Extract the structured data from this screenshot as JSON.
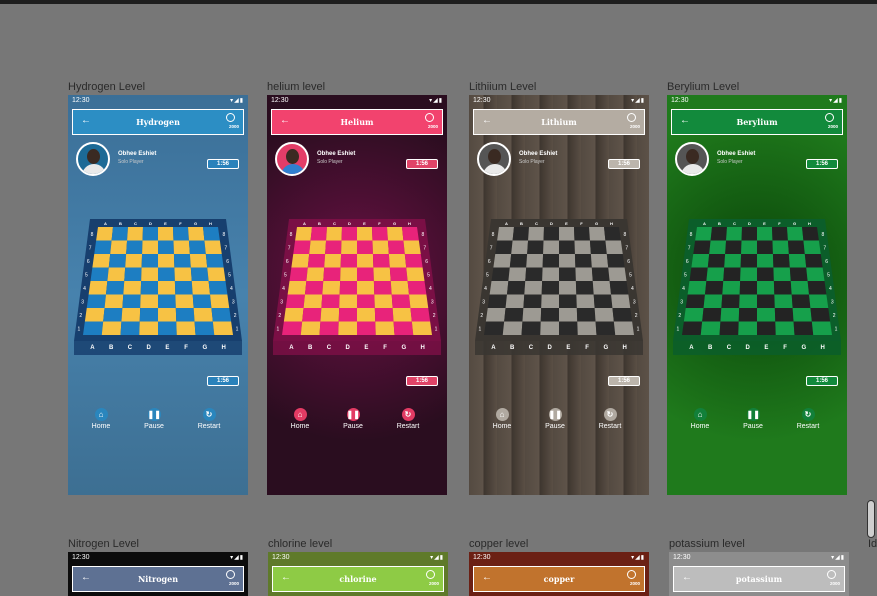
{
  "frames": [
    {
      "label": "Hydrogen Level",
      "title": "Hydrogen",
      "time": "12:30",
      "coins": "2000",
      "player": "Obhee Eshiet",
      "role": "Solo Player",
      "timer_top": "1:56",
      "timer_bottom": "1:56",
      "colors": {
        "bg": "#4179a3",
        "bgAlt": "#2f5f83",
        "header": "#2c8ec4",
        "light": "#f7c244",
        "dark": "#1d7ec2",
        "border": "#173f6e",
        "accent": "#2a86bd",
        "timer": "#2a82bb",
        "avatar": "#1c6a96"
      }
    },
    {
      "label": "helium level",
      "title": "Helium",
      "time": "12:30",
      "coins": "2000",
      "player": "Obhee Eshiet",
      "role": "Solo Player",
      "timer_top": "1:56",
      "timer_bottom": "1:56",
      "colors": {
        "bg": "#2a0d1f",
        "bgAlt": "#6b1145",
        "header": "#f2436e",
        "light": "#f7c244",
        "dark": "#e8237a",
        "border": "#7a0f45",
        "accent": "#e33b64",
        "timer": "#e04468",
        "avatar": "#e33d68"
      }
    },
    {
      "label": "Lithiium Level",
      "title": "Lithium",
      "time": "12:30",
      "coins": "2000",
      "player": "Obhee Eshiet",
      "role": "Solo Player",
      "timer_top": "1:56",
      "timer_bottom": "1:56",
      "colors": {
        "bg": "#5a4f45",
        "bgAlt": "#3f3730",
        "header": "#b4aca2",
        "light": "#9d9a93",
        "dark": "#2a2a2a",
        "border": "#3a3631",
        "accent": "#b0a9a0",
        "timer": "#bcb5ac",
        "avatar": "#555555"
      }
    },
    {
      "label": "Berylium Level",
      "title": "Berylium",
      "time": "12:30",
      "coins": "2000",
      "player": "Obhee Eshiet",
      "role": "Solo Player",
      "timer_top": "1:56",
      "timer_bottom": "1:56",
      "colors": {
        "bg": "#1f7a1c",
        "bgAlt": "#0a4409",
        "header": "#128a3c",
        "light": "#16a04b",
        "dark": "#232323",
        "border": "#0b5e2a",
        "accent": "#12803a",
        "timer": "#128a3c",
        "avatar": "#555555"
      }
    }
  ],
  "frames_row2": [
    {
      "label": "Nitrogen Level",
      "title": "Nitrogen",
      "time": "12:30",
      "coins": "2000",
      "colors": {
        "bg": "#0c0c0c",
        "header": "#5e7193"
      }
    },
    {
      "label": "chlorine level",
      "title": "chlorine",
      "time": "12:30",
      "coins": "2000",
      "colors": {
        "bg": "#5f7a2a",
        "header": "#8ecb45"
      }
    },
    {
      "label": "copper level",
      "title": "copper",
      "time": "12:30",
      "coins": "2000",
      "colors": {
        "bg": "#6b2014",
        "header": "#c1732d"
      }
    },
    {
      "label": "potassium level",
      "title": "potassium",
      "time": "12:30",
      "coins": "2000",
      "colors": {
        "bg": "#8d8d8d",
        "header": "#bdbdbd"
      }
    }
  ],
  "controls": [
    {
      "label": "Home",
      "icon": "home-icon",
      "glyph": "⌂"
    },
    {
      "label": "Pause",
      "icon": "pause-icon",
      "glyph": "❚❚"
    },
    {
      "label": "Restart",
      "icon": "restart-icon",
      "glyph": "↻"
    }
  ],
  "board": {
    "files": [
      "A",
      "B",
      "C",
      "D",
      "E",
      "F",
      "G",
      "H"
    ],
    "ranks": [
      "8",
      "7",
      "6",
      "5",
      "4",
      "3",
      "2",
      "1"
    ]
  },
  "partial_label": "Id"
}
